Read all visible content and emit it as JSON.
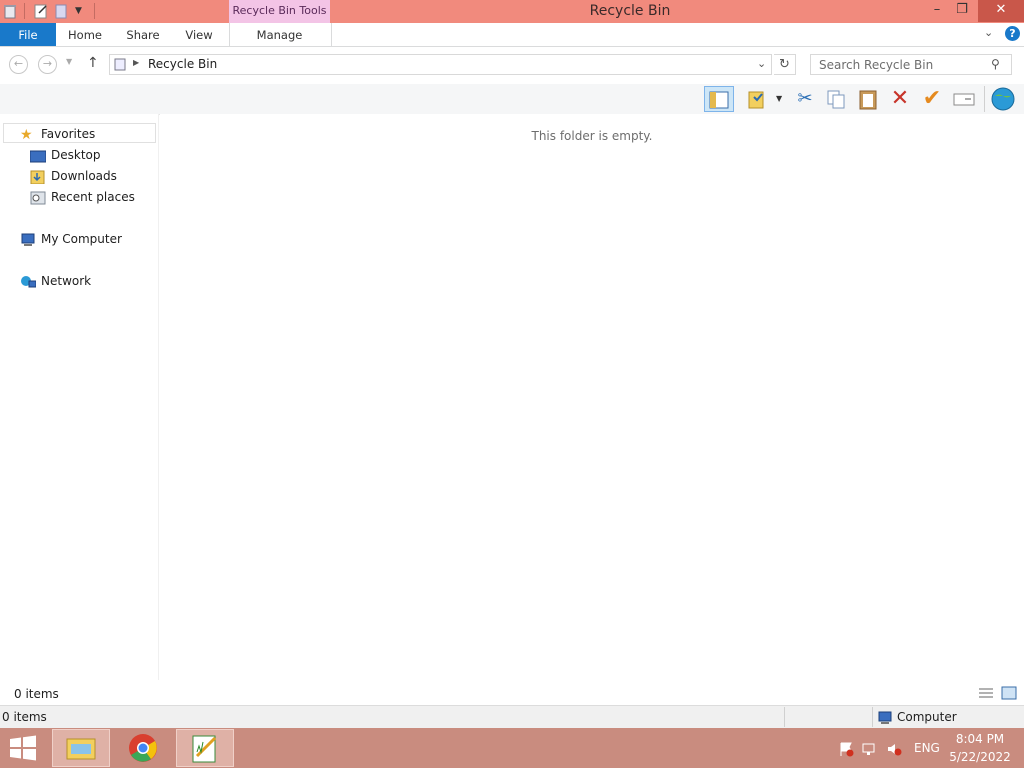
{
  "window": {
    "title": "Recycle Bin",
    "context_tab_group": "Recycle Bin Tools",
    "minimize": "–",
    "restore": "❐",
    "close": "✕"
  },
  "ribbon": {
    "tabs": [
      "File",
      "Home",
      "Share",
      "View",
      "Manage"
    ]
  },
  "address": {
    "path": "Recycle Bin",
    "search_placeholder": "Search Recycle Bin"
  },
  "toolbar": {
    "tools": [
      "preview-pane-icon",
      "folder-options-icon",
      "cut-icon",
      "copy-icon",
      "paste-icon",
      "delete-icon",
      "check-icon",
      "rename-icon",
      "world-icon"
    ]
  },
  "nav": {
    "favorites": "Favorites",
    "favorites_items": [
      "Desktop",
      "Downloads",
      "Recent places"
    ],
    "computer": "My Computer",
    "network": "Network"
  },
  "content": {
    "empty_message": "This folder is empty."
  },
  "status": {
    "items_count": "0 items",
    "bottom_items": "0 items",
    "location": "Computer"
  },
  "taskbar": {
    "language": "ENG",
    "time": "8:04 PM",
    "date": "5/22/2022",
    "apps": [
      "file-explorer-icon",
      "chrome-icon",
      "notepad-icon"
    ]
  },
  "colors": {
    "titlebar": "#f18a7d",
    "file_tab": "#1979ca",
    "taskbar": "#c98c7f",
    "context_tab": "#f3c4e6"
  }
}
